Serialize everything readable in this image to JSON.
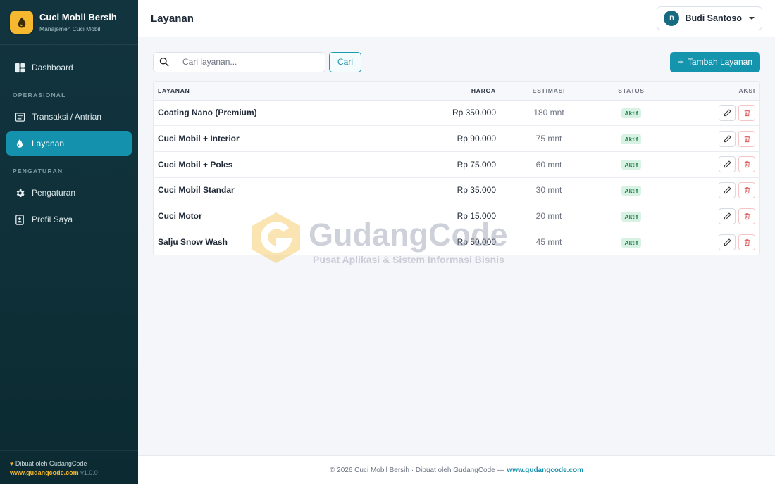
{
  "app": {
    "name": "Cuci Mobil Bersih",
    "subtitle": "Manajemen Cuci Mobil",
    "brand_color": "#f5b82e",
    "accent_color": "#1594ae"
  },
  "sidebar": {
    "items": [
      {
        "label": "Dashboard",
        "icon": "dashboard-icon"
      }
    ],
    "sections": [
      {
        "title": "OPERASIONAL",
        "items": [
          {
            "label": "Transaksi / Antrian",
            "icon": "list-icon"
          },
          {
            "label": "Layanan",
            "icon": "droplet-icon",
            "active": true
          }
        ]
      },
      {
        "title": "PENGATURAN",
        "items": [
          {
            "label": "Pengaturan",
            "icon": "gear-icon"
          },
          {
            "label": "Profil Saya",
            "icon": "id-badge-icon"
          }
        ]
      }
    ],
    "footer": {
      "made_by": "Dibuat oleh GudangCode",
      "site": "www.gudangcode.com",
      "version": "v1.0.0"
    }
  },
  "header": {
    "title": "Layanan",
    "user": {
      "initial": "B",
      "name": "Budi Santoso"
    }
  },
  "toolbar": {
    "search_placeholder": "Cari layanan...",
    "search_value": "",
    "search_button": "Cari",
    "add_button": "Tambah Layanan"
  },
  "table": {
    "columns": [
      "LAYANAN",
      "HARGA",
      "ESTIMASI",
      "STATUS",
      "AKSI"
    ],
    "rows": [
      {
        "name": "Coating Nano (Premium)",
        "price": "Rp 350.000",
        "estimate": "180 mnt",
        "status": "Aktif"
      },
      {
        "name": "Cuci Mobil + Interior",
        "price": "Rp 90.000",
        "estimate": "75 mnt",
        "status": "Aktif"
      },
      {
        "name": "Cuci Mobil + Poles",
        "price": "Rp 75.000",
        "estimate": "60 mnt",
        "status": "Aktif"
      },
      {
        "name": "Cuci Mobil Standar",
        "price": "Rp 35.000",
        "estimate": "30 mnt",
        "status": "Aktif"
      },
      {
        "name": "Cuci Motor",
        "price": "Rp 15.000",
        "estimate": "20 mnt",
        "status": "Aktif"
      },
      {
        "name": "Salju Snow Wash",
        "price": "Rp 50.000",
        "estimate": "45 mnt",
        "status": "Aktif"
      }
    ]
  },
  "watermark": {
    "title": "GudangCode",
    "subtitle": "Pusat Aplikasi & Sistem Informasi Bisnis"
  },
  "footer": {
    "text": "© 2026 Cuci Mobil Bersih · Dibuat oleh GudangCode —",
    "site": "www.gudangcode.com"
  }
}
